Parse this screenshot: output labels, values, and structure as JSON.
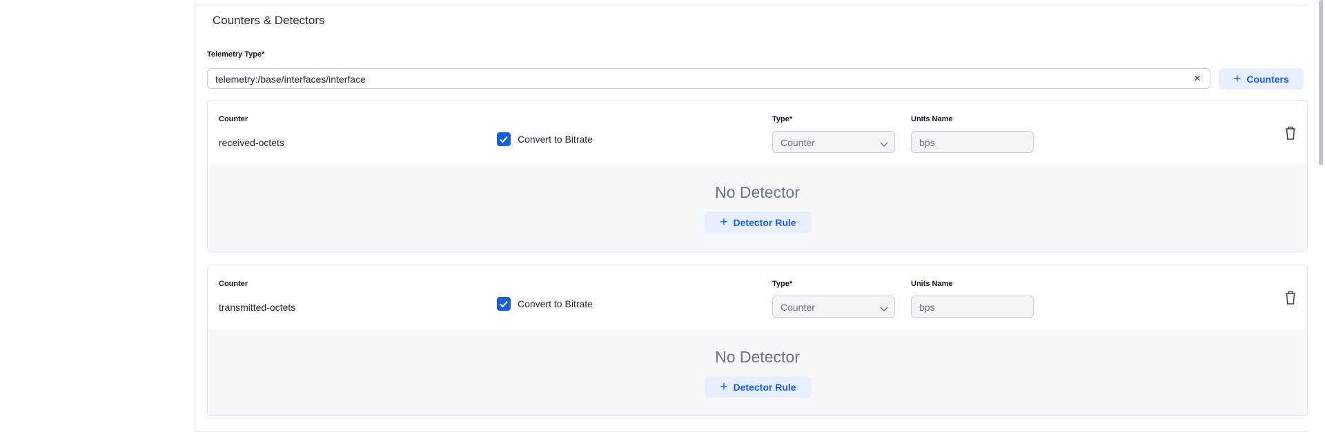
{
  "section": {
    "title": "Counters & Detectors",
    "telemetry_label": "Telemetry Type*",
    "telemetry_value": "telemetry:/base/interfaces/interface",
    "clear_icon": "×",
    "add_counters_label": "Counters"
  },
  "cards": [
    {
      "counter_label": "Counter",
      "counter_name": "received-octets",
      "convert_label": "Convert to Bitrate",
      "convert_checked": true,
      "type_label": "Type*",
      "type_value": "Counter",
      "units_label": "Units Name",
      "units_placeholder": "bps",
      "no_detector_text": "No Detector",
      "detector_button_label": "Detector Rule"
    },
    {
      "counter_label": "Counter",
      "counter_name": "transmitted-octets",
      "convert_label": "Convert to Bitrate",
      "convert_checked": true,
      "type_label": "Type*",
      "type_value": "Counter",
      "units_label": "Units Name",
      "units_placeholder": "bps",
      "no_detector_text": "No Detector",
      "detector_button_label": "Detector Rule"
    }
  ],
  "colors": {
    "accent": "#1a5ed8",
    "accent_bg": "#e7effd",
    "body_bg": "#f6f8fb"
  },
  "icons": {
    "plus": "plus-icon",
    "clear": "close-icon",
    "checkbox": "checkmark-icon",
    "select": "chevron-down-icon",
    "delete": "trash-icon"
  }
}
